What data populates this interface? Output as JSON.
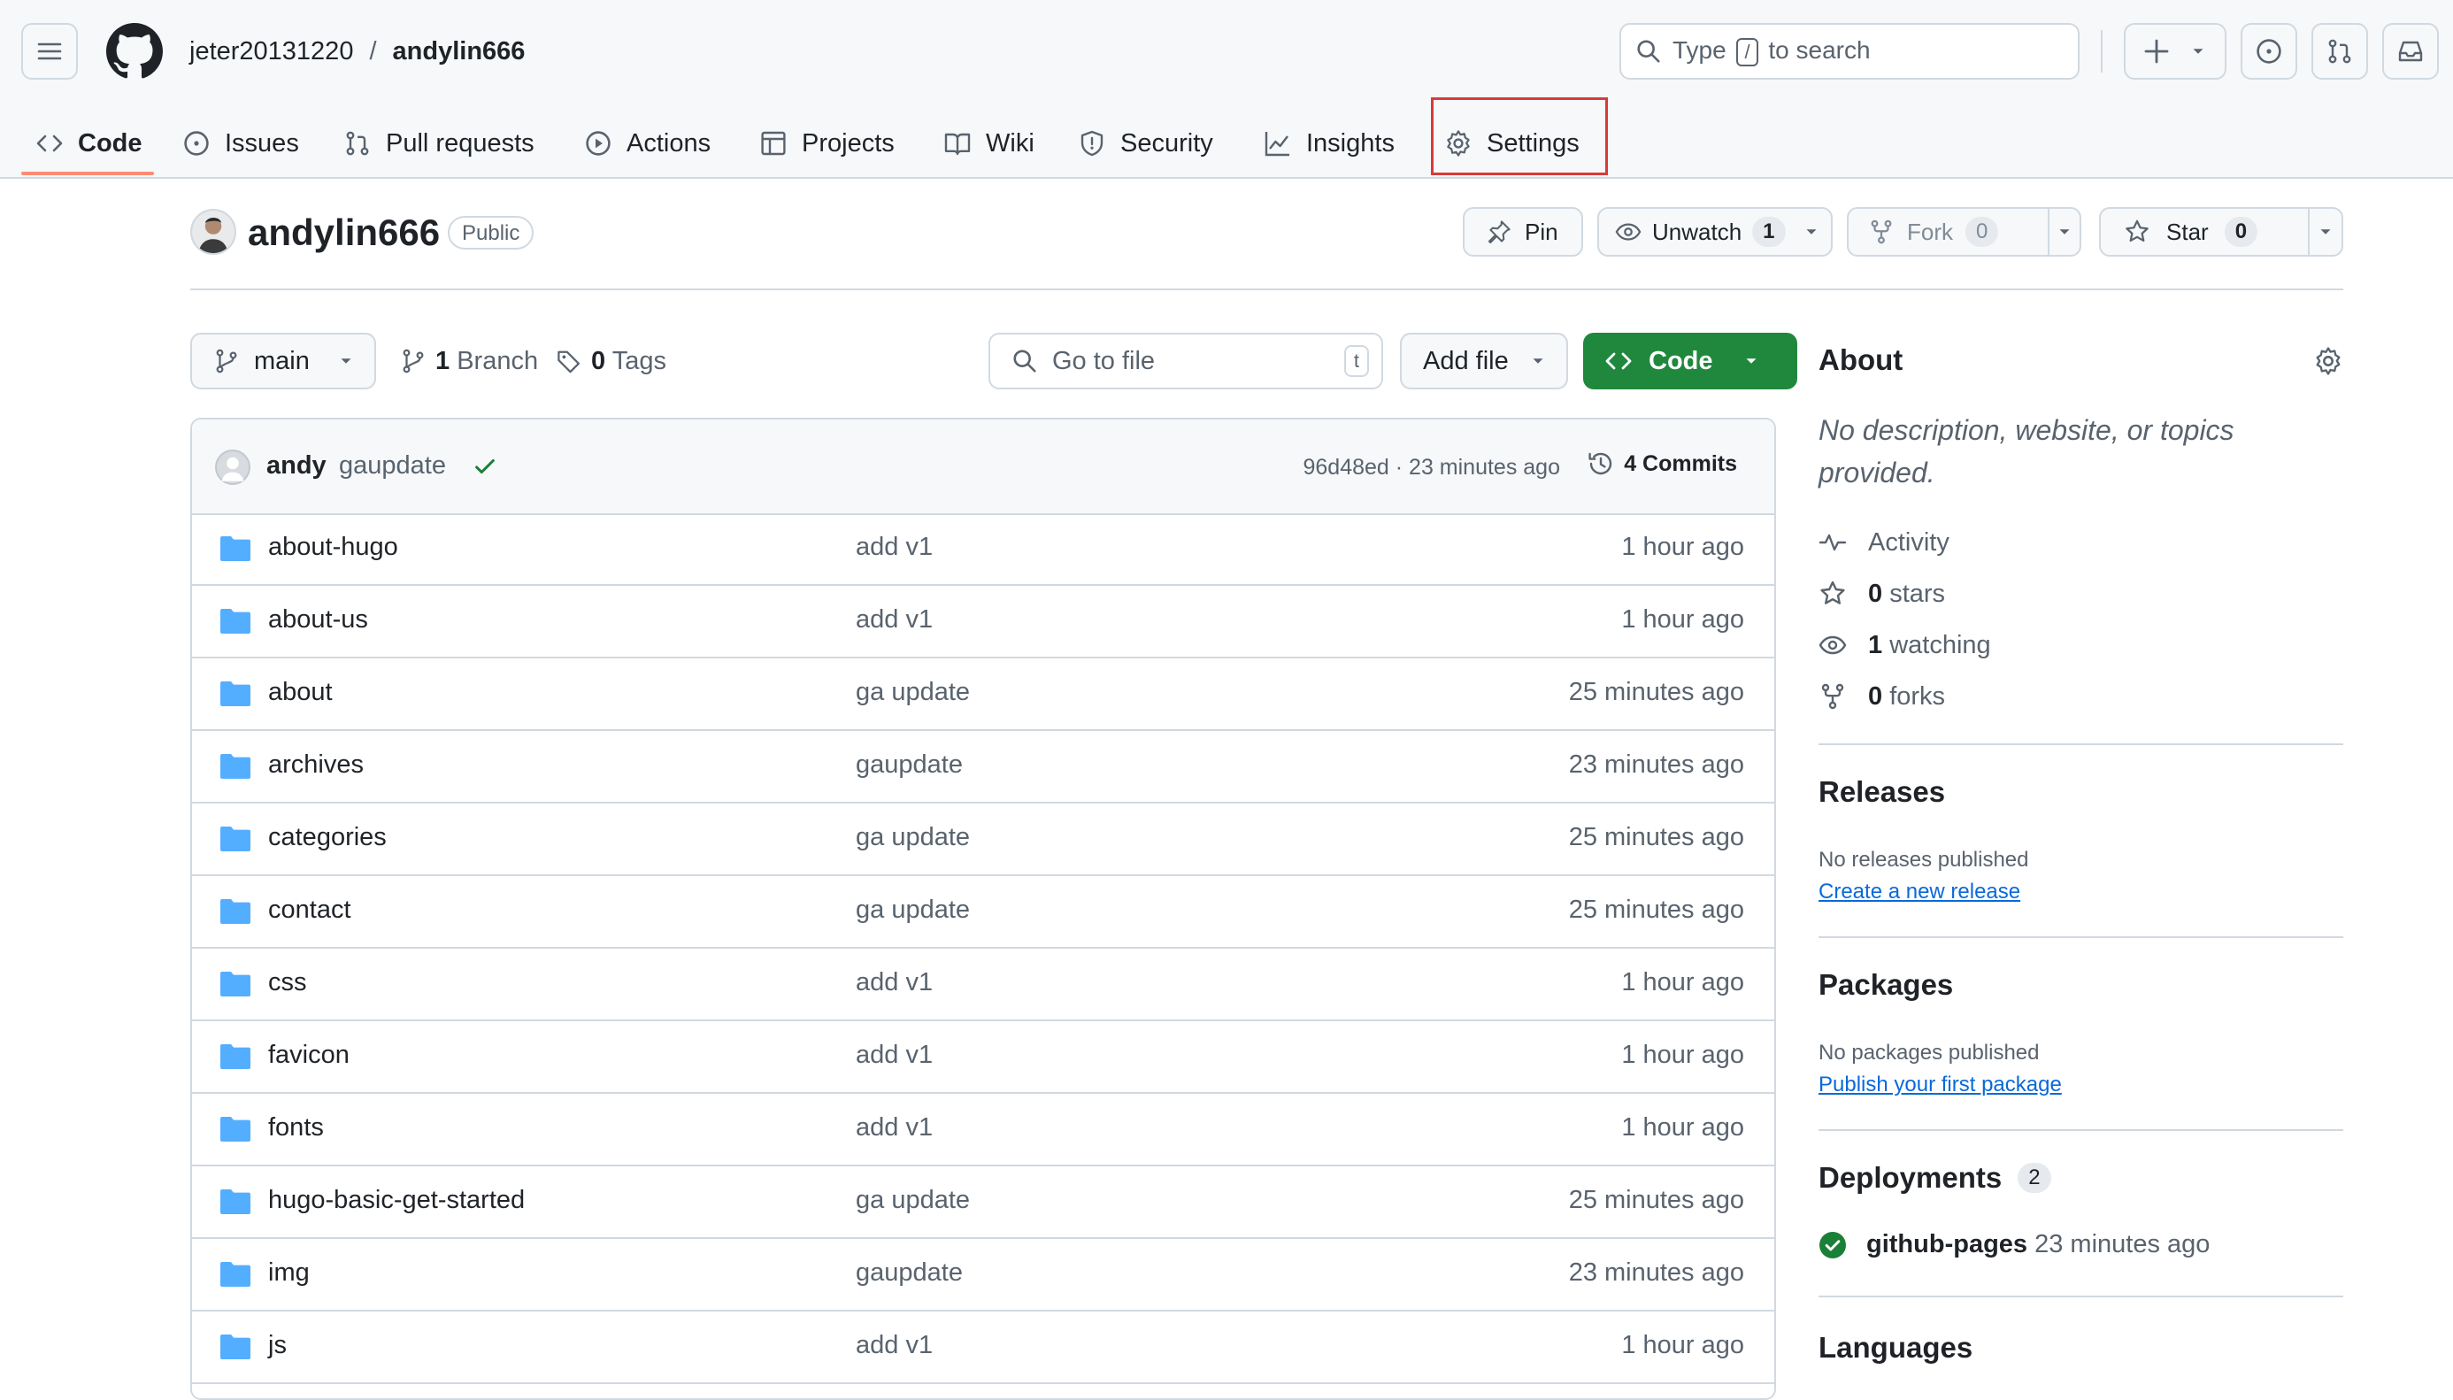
{
  "header": {
    "owner": "jeter20131220",
    "separator": "/",
    "repo": "andylin666",
    "search_prefix": "Type",
    "search_key": "/",
    "search_suffix": "to search"
  },
  "tabs": [
    {
      "label": "Code",
      "icon": "code-icon"
    },
    {
      "label": "Issues",
      "icon": "issue-icon"
    },
    {
      "label": "Pull requests",
      "icon": "pull-request-icon"
    },
    {
      "label": "Actions",
      "icon": "play-icon"
    },
    {
      "label": "Projects",
      "icon": "table-icon"
    },
    {
      "label": "Wiki",
      "icon": "book-icon"
    },
    {
      "label": "Security",
      "icon": "shield-icon"
    },
    {
      "label": "Insights",
      "icon": "graph-icon"
    },
    {
      "label": "Settings",
      "icon": "gear-icon"
    }
  ],
  "repo_head": {
    "name": "andylin666",
    "visibility": "Public",
    "pin_label": "Pin",
    "unwatch_label": "Unwatch",
    "watch_count": "1",
    "fork_label": "Fork",
    "fork_count": "0",
    "star_label": "Star",
    "star_count": "0"
  },
  "toolbar": {
    "branch": "main",
    "branch_count": "1",
    "branch_label": "Branch",
    "tag_count": "0",
    "tag_label": "Tags",
    "goto_placeholder": "Go to file",
    "goto_key": "t",
    "add_file_label": "Add file",
    "code_label": "Code"
  },
  "commit": {
    "author": "andy",
    "message": "gaupdate",
    "sha_time": "96d48ed · 23 minutes ago",
    "commits_label": "4 Commits"
  },
  "files": [
    {
      "name": "about-hugo",
      "message": "add v1",
      "age": "1 hour ago"
    },
    {
      "name": "about-us",
      "message": "add v1",
      "age": "1 hour ago"
    },
    {
      "name": "about",
      "message": "ga update",
      "age": "25 minutes ago"
    },
    {
      "name": "archives",
      "message": "gaupdate",
      "age": "23 minutes ago"
    },
    {
      "name": "categories",
      "message": "ga update",
      "age": "25 minutes ago"
    },
    {
      "name": "contact",
      "message": "ga update",
      "age": "25 minutes ago"
    },
    {
      "name": "css",
      "message": "add v1",
      "age": "1 hour ago"
    },
    {
      "name": "favicon",
      "message": "add v1",
      "age": "1 hour ago"
    },
    {
      "name": "fonts",
      "message": "add v1",
      "age": "1 hour ago"
    },
    {
      "name": "hugo-basic-get-started",
      "message": "ga update",
      "age": "25 minutes ago"
    },
    {
      "name": "img",
      "message": "gaupdate",
      "age": "23 minutes ago"
    },
    {
      "name": "js",
      "message": "add v1",
      "age": "1 hour ago"
    }
  ],
  "about": {
    "heading": "About",
    "description": "No description, website, or topics provided.",
    "activity": "Activity",
    "stars_count": "0",
    "stars_label": "stars",
    "watching_count": "1",
    "watching_label": "watching",
    "forks_count": "0",
    "forks_label": "forks"
  },
  "releases": {
    "heading": "Releases",
    "status": "No releases published",
    "link": "Create a new release"
  },
  "packages": {
    "heading": "Packages",
    "status": "No packages published",
    "link": "Publish your first package"
  },
  "deployments": {
    "heading": "Deployments",
    "count": "2",
    "env": "github-pages",
    "time": "23 minutes ago"
  },
  "languages": {
    "heading": "Languages"
  },
  "colors": {
    "accent_underline": "#fd8c73",
    "highlight_border": "#d93a3a",
    "code_button": "#1f883d",
    "folder": "#54aeff",
    "success": "#1a7f37",
    "link": "#0969da"
  }
}
